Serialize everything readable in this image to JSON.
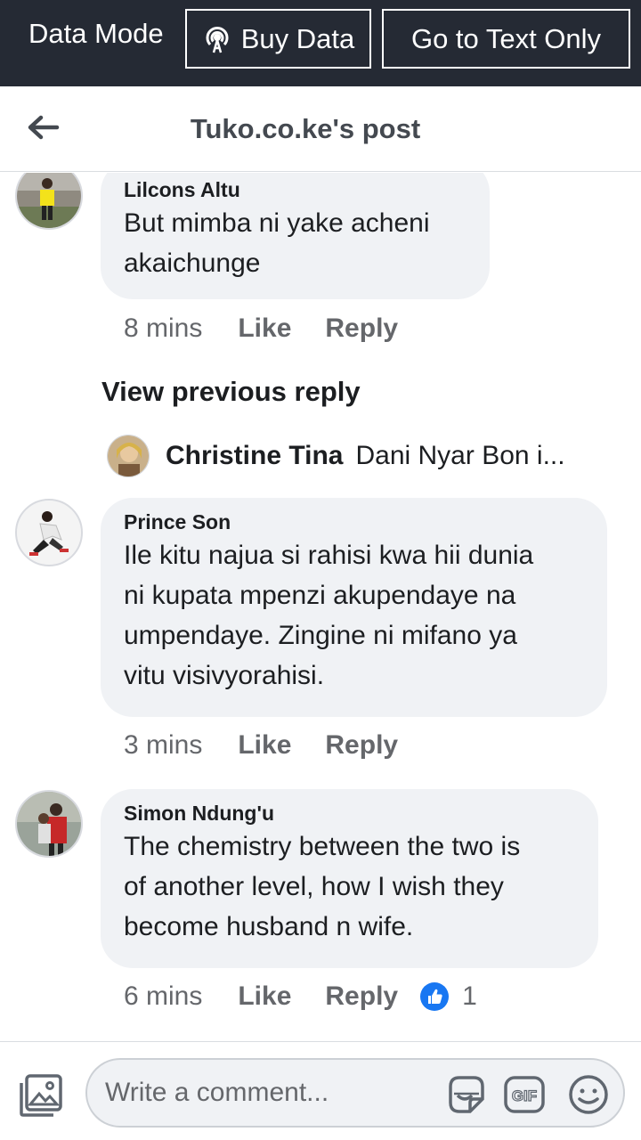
{
  "databar": {
    "mode_label": "Data Mode",
    "buy_label": "Buy Data",
    "text_only_label": "Go to Text Only"
  },
  "header": {
    "title": "Tuko.co.ke's post"
  },
  "comments": [
    {
      "name": "Lilcons Altu",
      "lines": [
        "But mimba ni yake acheni",
        "akaichunge"
      ],
      "time": "8 mins",
      "like": "Like",
      "reply": "Reply"
    },
    {
      "name": "Prince Son",
      "lines": [
        "Ile kitu najua si rahisi kwa hii dunia",
        "ni kupata mpenzi akupendaye na",
        "umpendaye. Zingine ni mifano ya",
        "vitu visivyorahisi."
      ],
      "time": "3 mins",
      "like": "Like",
      "reply": "Reply"
    },
    {
      "name": "Simon Ndung'u",
      "lines": [
        "The chemistry between the two is",
        "of another level, how I wish they",
        "become husband n wife."
      ],
      "time": "6 mins",
      "like": "Like",
      "reply": "Reply",
      "like_count": "1"
    }
  ],
  "view_previous": "View previous reply",
  "reply_preview": {
    "name": "Christine Tina",
    "text": "Dani Nyar Bon i..."
  },
  "composer": {
    "placeholder": "Write a comment..."
  },
  "colors": {
    "databar_bg": "#252a34",
    "bubble_bg": "#f0f2f5",
    "like_blue": "#1877f2"
  }
}
